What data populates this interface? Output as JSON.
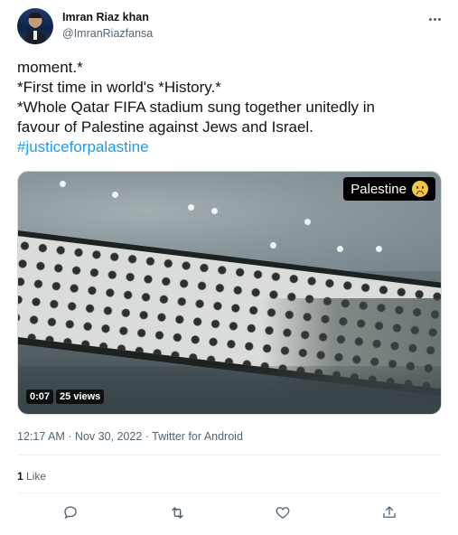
{
  "author": {
    "name": "Imran Riaz khan",
    "handle": "@ImranRiazfansa"
  },
  "tweet": {
    "lines": [
      "moment.*",
      "*First time in world's *History.*",
      "*Whole Qatar FIFA stadium sung together unitedly in",
      "favour of Palestine against Jews and Israel."
    ],
    "hashtag": "#justiceforpalastine"
  },
  "media": {
    "overlay_text": "Palestine",
    "overlay_emoji_icon": "sad-face-icon",
    "duration": "0:07",
    "views": "25 views"
  },
  "meta": {
    "timestamp": "12:17 AM · Nov 30, 2022 · Twitter for Android"
  },
  "engagement": {
    "like_count": "1",
    "like_label": "Like"
  },
  "actions": [
    "reply-icon",
    "retweet-icon",
    "like-icon",
    "share-icon"
  ],
  "colors": {
    "text": "#0f1419",
    "secondary": "#536471",
    "link": "#1d9bf0",
    "divider": "#eff3f4"
  }
}
